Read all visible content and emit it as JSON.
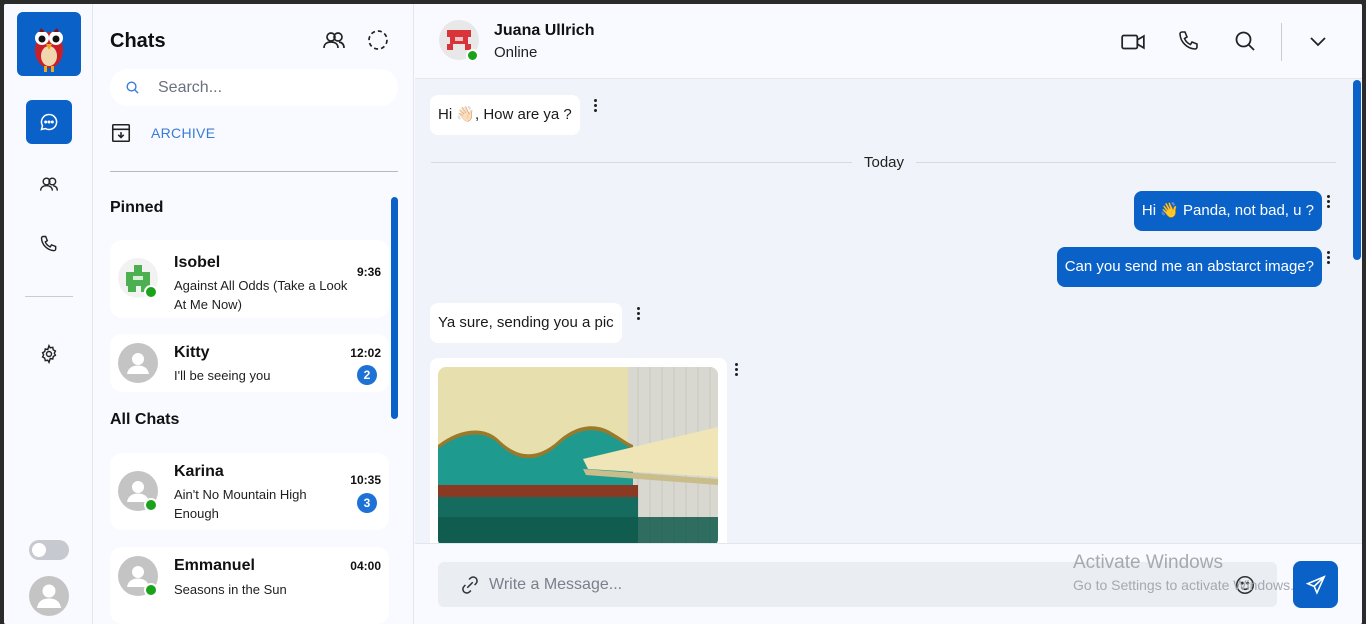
{
  "rail": {
    "items": [
      {
        "name": "chats-nav-icon",
        "active": true
      },
      {
        "name": "groups-nav-icon",
        "active": false
      },
      {
        "name": "calls-nav-icon",
        "active": false
      },
      {
        "name": "settings-nav-icon",
        "active": false
      }
    ],
    "accent": "#0a62c9"
  },
  "chats_panel": {
    "title": "Chats",
    "search_placeholder": "Search...",
    "archive_label": "ARCHIVE",
    "pinned_title": "Pinned",
    "all_title": "All Chats",
    "pinned": [
      {
        "name": "Isobel",
        "message": "Against All Odds (Take a Look At Me Now)",
        "time": "9:36",
        "online": true
      },
      {
        "name": "Kitty",
        "message": "I'll be seeing you",
        "time": "12:02",
        "unread": "2",
        "online": false
      }
    ],
    "all": [
      {
        "name": "Karina",
        "message": "Ain't No Mountain High Enough",
        "time": "10:35",
        "unread": "3",
        "online": true
      },
      {
        "name": "Emmanuel",
        "message": "Seasons in the Sun",
        "time": "04:00",
        "online": true
      }
    ]
  },
  "conversation": {
    "contact_name": "Juana Ullrich",
    "contact_status": "Online",
    "day_label": "Today",
    "messages": [
      {
        "direction": "in",
        "text": "Hi 👋🏻, How are ya ?"
      },
      {
        "direction": "out",
        "text": "Hi 👋 Panda, not bad, u ?"
      },
      {
        "direction": "out",
        "text": "Can you send me an abstarct image?"
      },
      {
        "direction": "in",
        "text": "Ya sure, sending you a pic"
      },
      {
        "direction": "in",
        "type": "image"
      }
    ],
    "composer_placeholder": "Write a Message..."
  },
  "watermark": {
    "title": "Activate Windows",
    "subtitle": "Go to Settings to activate Windows."
  }
}
